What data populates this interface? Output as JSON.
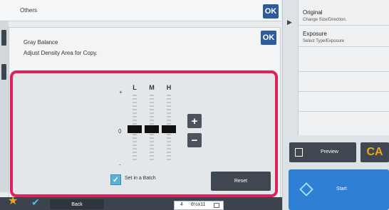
{
  "header": {
    "title": "Others",
    "ok_label": "OK"
  },
  "dialog": {
    "title": "Gray Balance",
    "subtitle": "Adjust Density Area for Copy.",
    "ok_label": "OK"
  },
  "adjuster": {
    "plus_mark": "+",
    "zero_mark": "0",
    "minus_mark": "-",
    "columns": [
      {
        "label": "L",
        "level": 0
      },
      {
        "label": "M",
        "level": 0
      },
      {
        "label": "H",
        "level": 0
      }
    ],
    "plus_button": "+",
    "minus_button": "−",
    "batch_label": "Set in a Batch",
    "batch_checked": true,
    "reset_label": "Reset",
    "highlight_color": "#e0205a"
  },
  "bottom": {
    "back_label": "Back",
    "paper_tray": "4",
    "paper_size": "8½x11"
  },
  "right": {
    "items": [
      {
        "title": "Original",
        "subtitle": "Change Size/Direction."
      },
      {
        "title": "Exposure",
        "subtitle": "Select Type/Exposure"
      }
    ],
    "preview_label": "Preview",
    "ca_label": "CA",
    "start_label": "Start"
  }
}
